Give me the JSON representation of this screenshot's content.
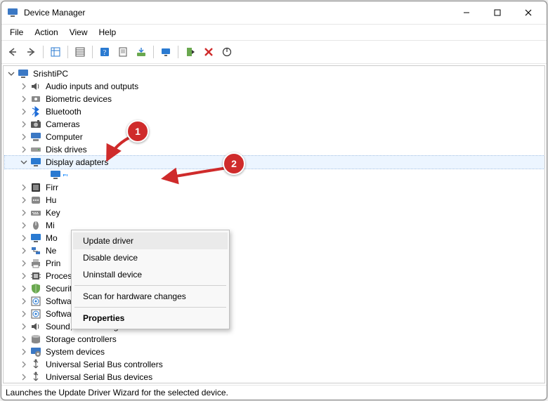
{
  "title": "Device Manager",
  "menu": {
    "items": [
      "File",
      "Action",
      "View",
      "Help"
    ]
  },
  "toolbar": {
    "buttons": [
      {
        "name": "back-icon"
      },
      {
        "name": "forward-icon"
      },
      {
        "sep": true
      },
      {
        "name": "show-hidden-icon"
      },
      {
        "sep": true
      },
      {
        "name": "properties-grid-icon"
      },
      {
        "sep": true
      },
      {
        "name": "help-icon"
      },
      {
        "name": "properties-icon"
      },
      {
        "name": "scan-hardware-icon"
      },
      {
        "sep": true
      },
      {
        "name": "update-driver-icon"
      },
      {
        "sep": true
      },
      {
        "name": "enable-icon"
      },
      {
        "name": "uninstall-icon"
      },
      {
        "name": "disk-icon"
      }
    ]
  },
  "tree": {
    "root": {
      "label": "SrishtiPC",
      "icon": "monitor-icon"
    },
    "nodes": [
      {
        "label": "Audio inputs and outputs",
        "icon": "speaker-icon"
      },
      {
        "label": "Biometric devices",
        "icon": "sensor-icon"
      },
      {
        "label": "Bluetooth",
        "icon": "bluetooth-icon"
      },
      {
        "label": "Cameras",
        "icon": "camera-icon"
      },
      {
        "label": "Computer",
        "icon": "computer-icon"
      },
      {
        "label": "Disk drives",
        "icon": "disk-drive-icon"
      },
      {
        "label": "Display adapters",
        "icon": "display-icon",
        "expanded": true,
        "highlight": true,
        "children": [
          {
            "label": "",
            "icon": "display-icon",
            "selected": true
          }
        ]
      },
      {
        "label": "Firr",
        "icon": "firmware-icon"
      },
      {
        "label": "Hu",
        "icon": "hid-icon"
      },
      {
        "label": "Key",
        "icon": "keyboard-icon"
      },
      {
        "label": "Mi",
        "icon": "mouse-icon"
      },
      {
        "label": "Mo",
        "icon": "display-icon"
      },
      {
        "label": "Ne",
        "icon": "network-icon"
      },
      {
        "label": "Prin",
        "icon": "printer-icon"
      },
      {
        "label": "Processors",
        "icon": "cpu-icon"
      },
      {
        "label": "Security devices",
        "icon": "security-icon"
      },
      {
        "label": "Software components",
        "icon": "software-icon"
      },
      {
        "label": "Software devices",
        "icon": "software-icon"
      },
      {
        "label": "Sound, video and game controllers",
        "icon": "speaker-icon"
      },
      {
        "label": "Storage controllers",
        "icon": "storage-icon"
      },
      {
        "label": "System devices",
        "icon": "system-icon"
      },
      {
        "label": "Universal Serial Bus controllers",
        "icon": "usb-icon"
      },
      {
        "label": "Universal Serial Bus devices",
        "icon": "usb-icon"
      }
    ]
  },
  "context_menu": {
    "items": [
      {
        "label": "Update driver",
        "hover": true
      },
      {
        "label": "Disable device"
      },
      {
        "label": "Uninstall device"
      },
      {
        "sep": true
      },
      {
        "label": "Scan for hardware changes"
      },
      {
        "sep": true
      },
      {
        "label": "Properties",
        "bold": true
      }
    ]
  },
  "status": "Launches the Update Driver Wizard for the selected device.",
  "annotations": {
    "badge1": "1",
    "badge2": "2"
  }
}
